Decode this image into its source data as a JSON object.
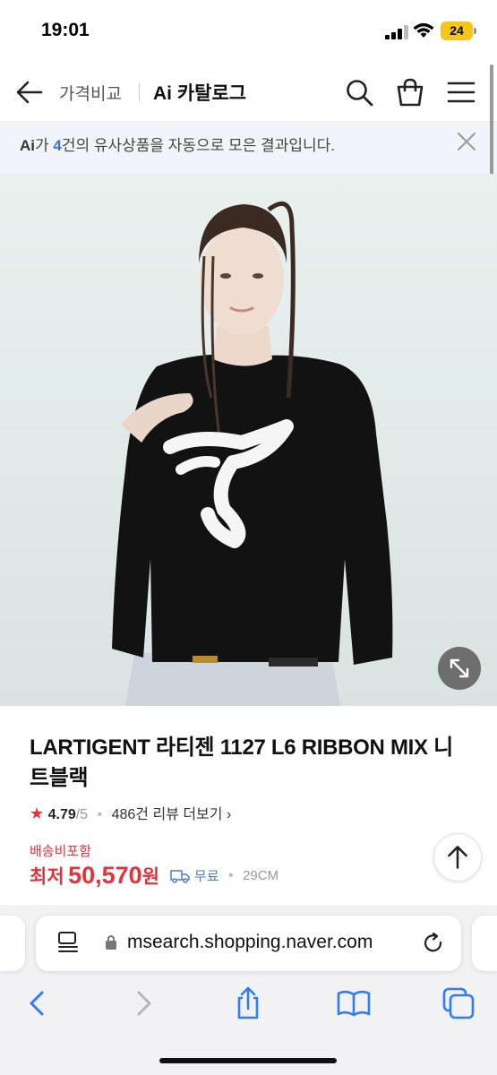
{
  "status_bar": {
    "time": "19:01",
    "battery": "24"
  },
  "header": {
    "back_icon": "arrow-left-icon",
    "link_label": "가격비교",
    "title": "Ai 카탈로그",
    "icons": [
      "search-icon",
      "shopping-bag-icon",
      "menu-icon"
    ]
  },
  "ai_banner": {
    "logo": "Ai",
    "prefix": "가 ",
    "count": "4",
    "suffix": "건의 유사상품을 자동으로 모은 결과입니다."
  },
  "product": {
    "title": "LARTIGENT 라티젠 1127 L6 RIBBON MIX 니트블랙",
    "rating": "4.79",
    "rating_max": "/5",
    "review_text": "486건 리뷰 더보기",
    "shipping_tag": "배송비포함",
    "price_label": "최저",
    "price": "50,570",
    "price_unit": "원",
    "delivery": "무료",
    "size": "29CM"
  },
  "browser": {
    "url": "msearch.shopping.naver.com",
    "toolbar_icons": [
      "back-icon",
      "forward-icon",
      "share-icon",
      "bookmarks-icon",
      "tabs-icon"
    ]
  },
  "colors": {
    "accent_red": "#e8303a",
    "accent_blue": "#3d6fe0",
    "banner_bg": "#f1f5fb"
  }
}
